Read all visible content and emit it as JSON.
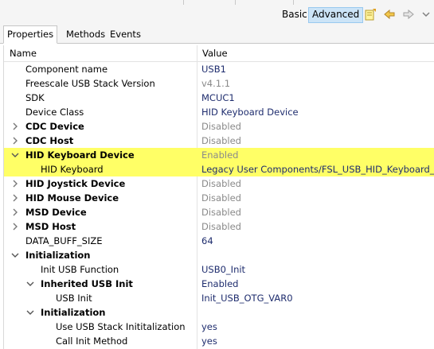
{
  "toolbar": {
    "basic_label": "Basic",
    "advanced_label": "Advanced",
    "icons": [
      "note-icon",
      "back-arrow-icon",
      "forward-arrow-icon"
    ]
  },
  "tabs": [
    {
      "label": "Properties",
      "active": true
    },
    {
      "label": "Methods",
      "active": false
    },
    {
      "label": "Events",
      "active": false
    }
  ],
  "table": {
    "col_name": "Name",
    "col_value": "Value",
    "rows": [
      {
        "name": "Component name",
        "value": "USB1",
        "bold": false,
        "indent": 1,
        "twisty": "none",
        "disabled": false
      },
      {
        "name": "Freescale USB Stack Version",
        "value": "v4.1.1",
        "bold": false,
        "indent": 1,
        "twisty": "none",
        "disabled": true
      },
      {
        "name": "SDK",
        "value": "MCUC1",
        "bold": false,
        "indent": 1,
        "twisty": "none",
        "disabled": false
      },
      {
        "name": "Device Class",
        "value": "HID Keyboard Device",
        "bold": false,
        "indent": 1,
        "twisty": "none",
        "disabled": false
      },
      {
        "name": "CDC Device",
        "value": "Disabled",
        "bold": true,
        "indent": 1,
        "twisty": "collapsed",
        "disabled": true
      },
      {
        "name": "CDC Host",
        "value": "Disabled",
        "bold": true,
        "indent": 1,
        "twisty": "collapsed",
        "disabled": true
      },
      {
        "name": "HID Keyboard Device",
        "value": "Enabled",
        "bold": true,
        "indent": 1,
        "twisty": "expanded",
        "disabled": true,
        "highlight": true
      },
      {
        "name": "HID Keyboard",
        "value": "Legacy User Components/FSL_USB_HID_Keyboard_Dev",
        "bold": false,
        "indent": 2,
        "twisty": "none",
        "disabled": false,
        "highlight": true
      },
      {
        "name": "HID Joystick Device",
        "value": "Disabled",
        "bold": true,
        "indent": 1,
        "twisty": "collapsed",
        "disabled": true
      },
      {
        "name": "HID Mouse Device",
        "value": "Disabled",
        "bold": true,
        "indent": 1,
        "twisty": "collapsed",
        "disabled": true
      },
      {
        "name": "MSD Device",
        "value": "Disabled",
        "bold": true,
        "indent": 1,
        "twisty": "collapsed",
        "disabled": true
      },
      {
        "name": "MSD Host",
        "value": "Disabled",
        "bold": true,
        "indent": 1,
        "twisty": "collapsed",
        "disabled": true
      },
      {
        "name": "DATA_BUFF_SIZE",
        "value": "64",
        "bold": false,
        "indent": 1,
        "twisty": "none",
        "disabled": false
      },
      {
        "name": "Initialization",
        "value": "",
        "bold": true,
        "indent": 1,
        "twisty": "expanded",
        "disabled": false
      },
      {
        "name": "Init USB Function",
        "value": "USB0_Init",
        "bold": false,
        "indent": 2,
        "twisty": "none",
        "disabled": false
      },
      {
        "name": "Inherited USB Init",
        "value": "Enabled",
        "bold": true,
        "indent": 2,
        "twisty": "expanded",
        "disabled": false
      },
      {
        "name": "USB Init",
        "value": "Init_USB_OTG_VAR0",
        "bold": false,
        "indent": 3,
        "twisty": "none",
        "disabled": false
      },
      {
        "name": "Initialization",
        "value": "",
        "bold": true,
        "indent": 2,
        "twisty": "expanded",
        "disabled": false
      },
      {
        "name": "Use USB Stack Inititalization",
        "value": "yes",
        "bold": false,
        "indent": 3,
        "twisty": "none",
        "disabled": false
      },
      {
        "name": "Call Init Method",
        "value": "yes",
        "bold": false,
        "indent": 3,
        "twisty": "none",
        "disabled": false
      }
    ]
  },
  "colors": {
    "highlight": "#ffff66",
    "value_text": "#1f2d6e",
    "disabled_text": "#8a8a8a",
    "selected_toolbar": "#cce4f7"
  }
}
